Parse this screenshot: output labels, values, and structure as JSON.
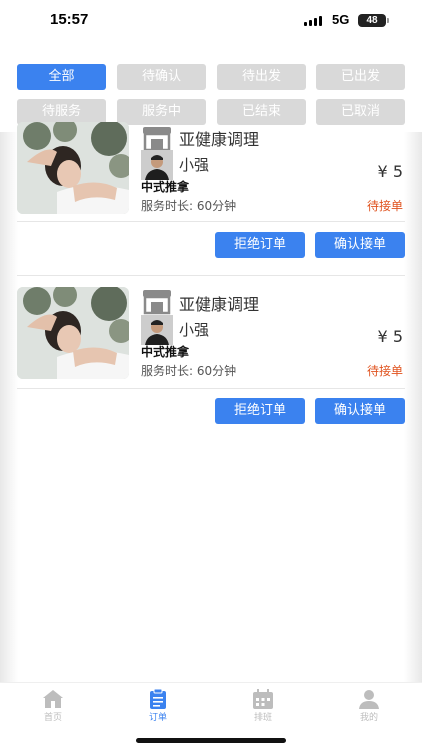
{
  "status_bar": {
    "time": "15:57",
    "network": "5G",
    "battery": "48"
  },
  "tabs": [
    {
      "label": "全部",
      "active": true
    },
    {
      "label": "待确认",
      "active": false
    },
    {
      "label": "待出发",
      "active": false
    },
    {
      "label": "已出发",
      "active": false
    },
    {
      "label": "待服务",
      "active": false
    },
    {
      "label": "服务中",
      "active": false
    },
    {
      "label": "已结束",
      "active": false
    },
    {
      "label": "已取消",
      "active": false
    }
  ],
  "orders": [
    {
      "shop": "亚健康调理",
      "staff": "小强",
      "price": "¥ 5",
      "service": "中式推拿",
      "duration": "服务时长: 60分钟",
      "status": "待接单",
      "reject_label": "拒绝订单",
      "accept_label": "确认接单"
    },
    {
      "shop": "亚健康调理",
      "staff": "小强",
      "price": "¥ 5",
      "service": "中式推拿",
      "duration": "服务时长: 60分钟",
      "status": "待接单",
      "reject_label": "拒绝订单",
      "accept_label": "确认接单"
    }
  ],
  "bottom_nav": [
    {
      "label": "首页",
      "icon": "home-icon",
      "active": false
    },
    {
      "label": "订单",
      "icon": "order-icon",
      "active": true
    },
    {
      "label": "排班",
      "icon": "calendar-icon",
      "active": false
    },
    {
      "label": "我的",
      "icon": "user-icon",
      "active": false
    }
  ],
  "colors": {
    "accent": "#3b82ef",
    "status": "#e0531f",
    "tab_inactive": "#d9d9d9"
  }
}
